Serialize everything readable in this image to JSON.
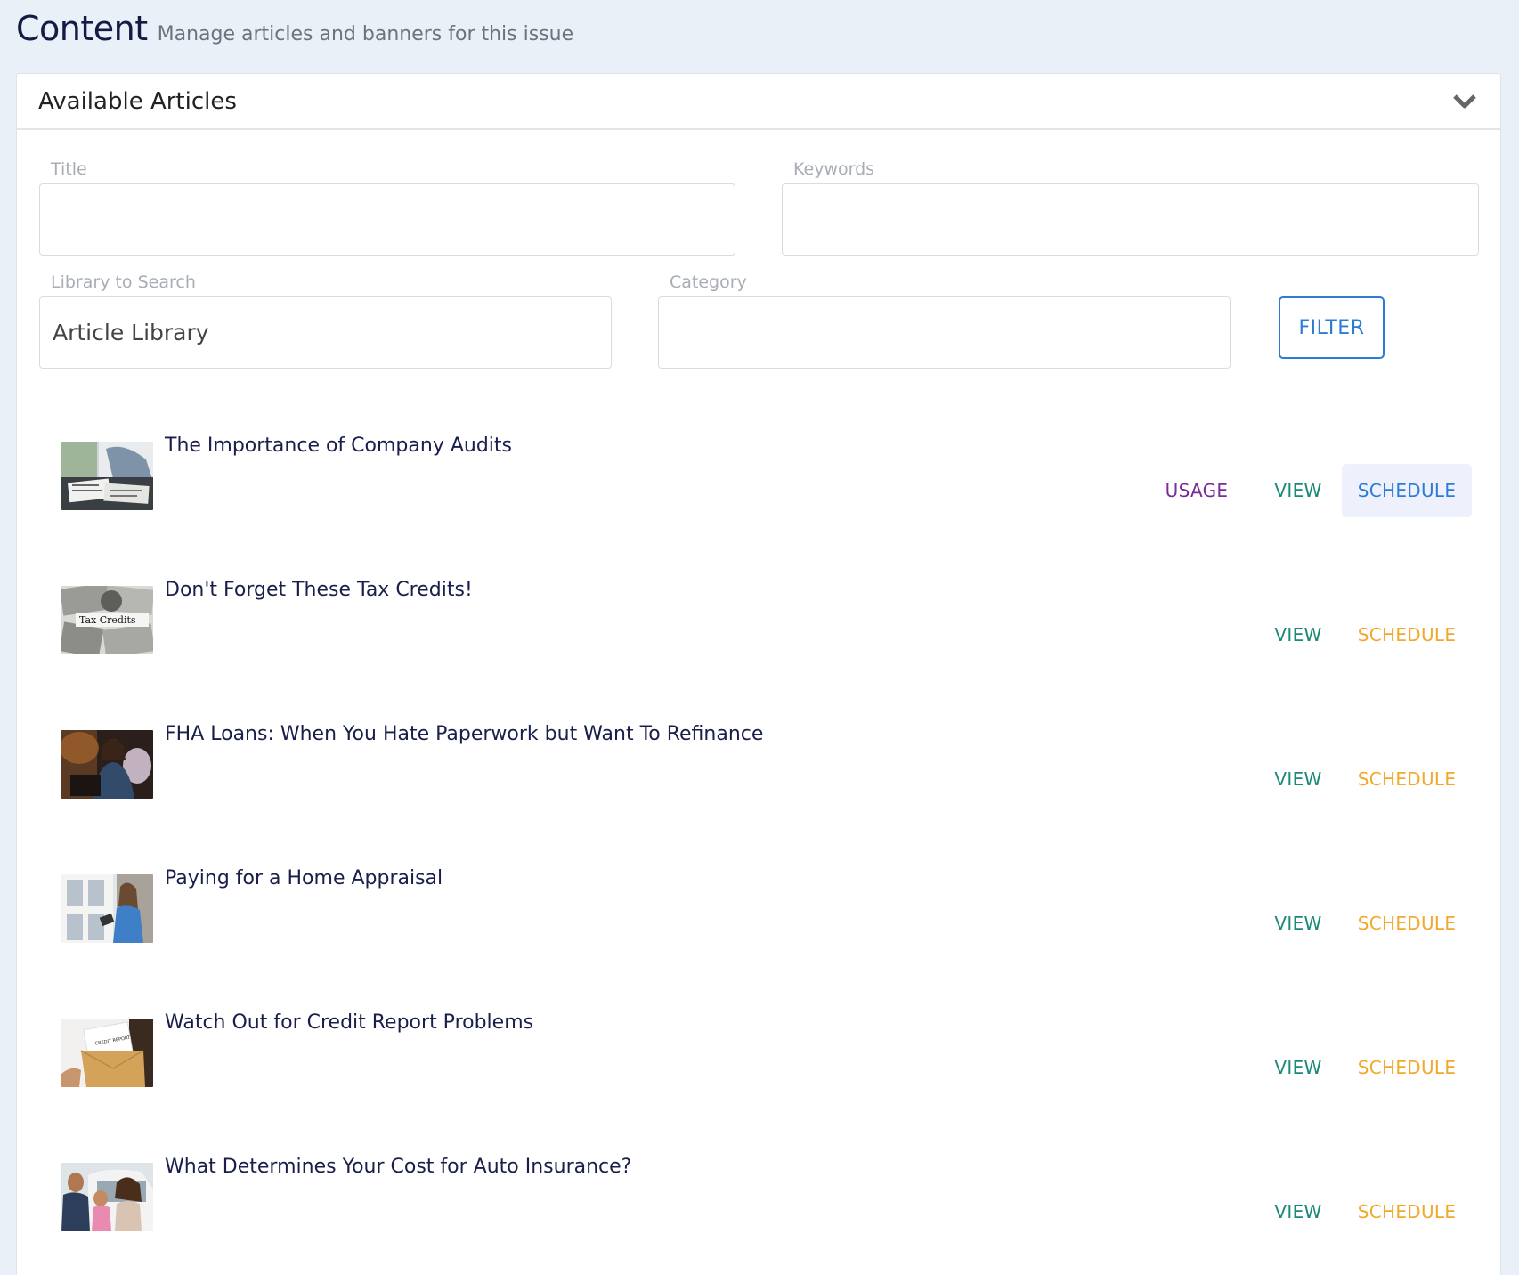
{
  "header": {
    "title": "Content",
    "subtitle": "Manage articles and banners for this issue"
  },
  "panel": {
    "title": "Available Articles",
    "toggle_icon": "chevron-down-icon"
  },
  "filters": {
    "title_label": "Title",
    "title_value": "",
    "keywords_label": "Keywords",
    "keywords_value": "",
    "library_label": "Library to Search",
    "library_value": "Article Library",
    "category_label": "Category",
    "category_value": "",
    "filter_button": "FILTER"
  },
  "actions": {
    "usage": "USAGE",
    "view": "VIEW",
    "schedule": "SCHEDULE"
  },
  "articles": [
    {
      "title": "The Importance of Company Audits",
      "thumbnail": "business-documents-photo"
    },
    {
      "title": "Don't Forget These Tax Credits!",
      "thumbnail": "tax-credits-money-photo",
      "thumb_text": "Tax Credits"
    },
    {
      "title": "FHA Loans: When You Hate Paperwork but Want To Refinance",
      "thumbnail": "woman-at-laptop-photo"
    },
    {
      "title": "Paying for a Home Appraisal",
      "thumbnail": "home-appraiser-photo"
    },
    {
      "title": "Watch Out for Credit Report Problems",
      "thumbnail": "credit-report-envelope-photo",
      "thumb_text": "CREDIT REPORT"
    },
    {
      "title": "What Determines Your Cost for Auto Insurance?",
      "thumbnail": "family-by-car-photo"
    }
  ],
  "colors": {
    "usage": "#7a2a9a",
    "view": "#1a8a78",
    "schedule": "#f2a82c",
    "schedule_active": "#2c7cd6",
    "filter": "#2c7cd6"
  }
}
